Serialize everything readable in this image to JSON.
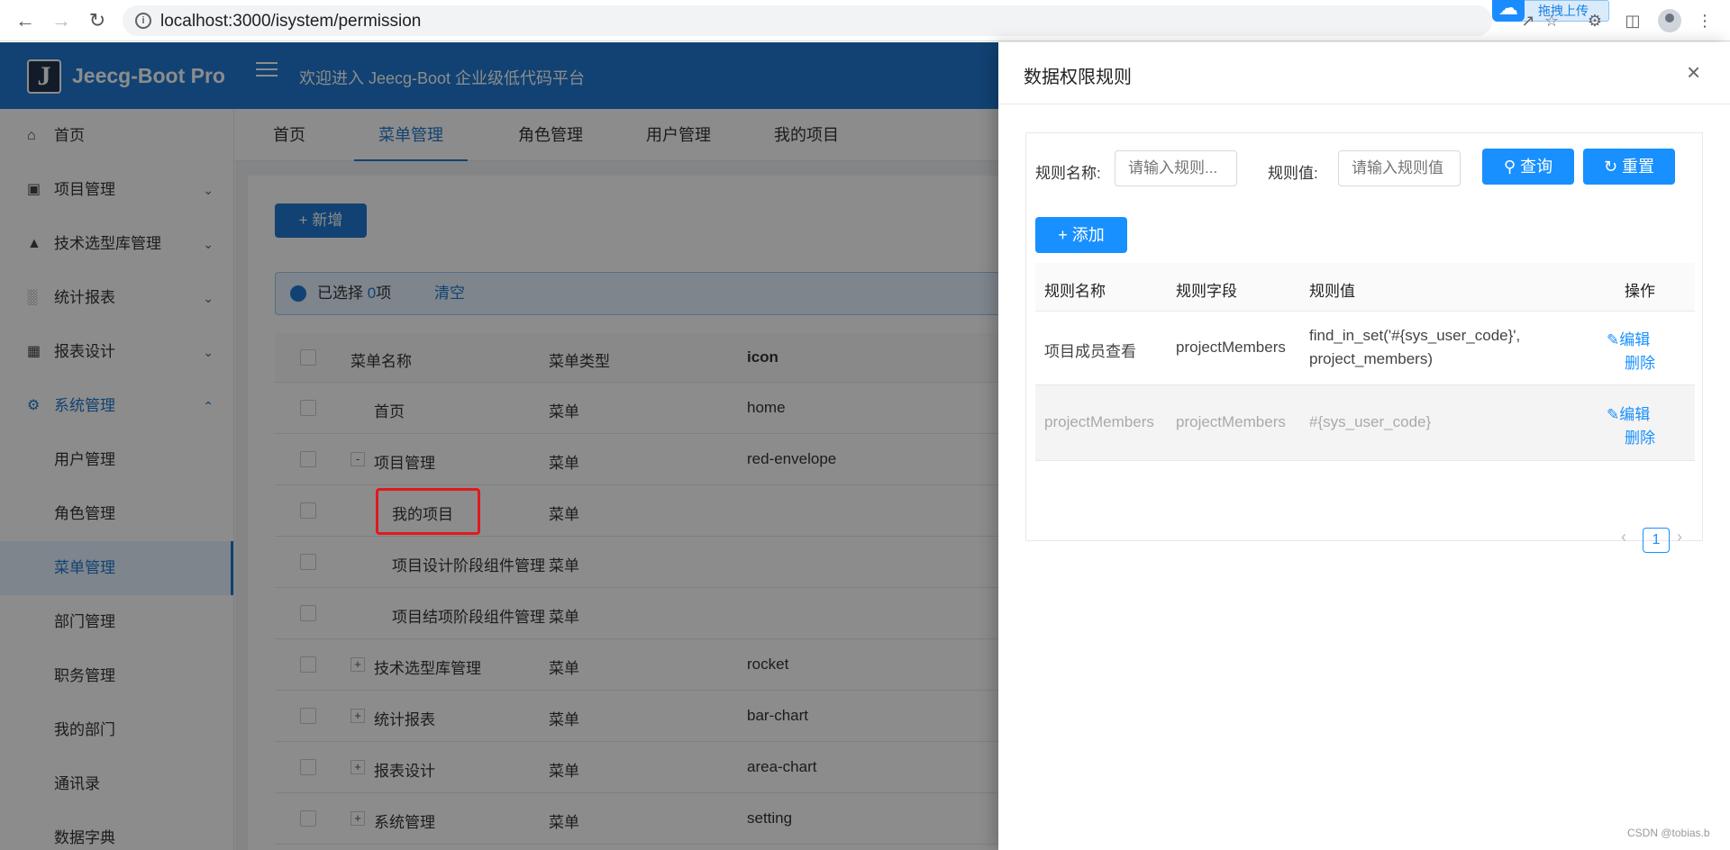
{
  "browser": {
    "url": "localhost:3000/isystem/permission",
    "upload_label": "拖拽上传"
  },
  "app": {
    "logo_letter": "J",
    "logo_text": "Jeecg-Boot Pro",
    "welcome": "欢迎进入 Jeecg-Boot 企业级低代码平台"
  },
  "sidebar": {
    "items": [
      {
        "label": "首页",
        "icon": "home-icon"
      },
      {
        "label": "项目管理",
        "icon": "project-icon"
      },
      {
        "label": "技术选型库管理",
        "icon": "rocket-icon"
      },
      {
        "label": "统计报表",
        "icon": "bar-chart-icon"
      },
      {
        "label": "报表设计",
        "icon": "area-chart-icon"
      },
      {
        "label": "系统管理",
        "icon": "setting-icon"
      }
    ],
    "sub_items": [
      "用户管理",
      "角色管理",
      "菜单管理",
      "部门管理",
      "职务管理",
      "我的部门",
      "通讯录",
      "数据字典"
    ]
  },
  "tabs": [
    "首页",
    "菜单管理",
    "角色管理",
    "用户管理",
    "我的项目"
  ],
  "toolbar": {
    "add_label": "新增"
  },
  "selection": {
    "prefix": "已选择 ",
    "count": "0",
    "suffix": "项",
    "clear": "清空"
  },
  "table": {
    "headers": [
      "菜单名称",
      "菜单类型",
      "icon"
    ],
    "rows": [
      {
        "name": "首页",
        "type": "菜单",
        "icon": "home"
      },
      {
        "name": "项目管理",
        "type": "菜单",
        "icon": "red-envelope",
        "expand": "-"
      },
      {
        "name": "我的项目",
        "type": "菜单",
        "icon": ""
      },
      {
        "name": "项目设计阶段组件管理",
        "type": "菜单",
        "icon": ""
      },
      {
        "name": "项目结项阶段组件管理",
        "type": "菜单",
        "icon": ""
      },
      {
        "name": "技术选型库管理",
        "type": "菜单",
        "icon": "rocket",
        "expand": "+"
      },
      {
        "name": "统计报表",
        "type": "菜单",
        "icon": "bar-chart",
        "expand": "+"
      },
      {
        "name": "报表设计",
        "type": "菜单",
        "icon": "area-chart",
        "expand": "+"
      },
      {
        "name": "系统管理",
        "type": "菜单",
        "icon": "setting",
        "expand": "+"
      }
    ]
  },
  "drawer": {
    "title": "数据权限规则",
    "rule_name_label": "规则名称:",
    "rule_name_placeholder": "请输入规则...",
    "rule_value_label": "规则值:",
    "rule_value_placeholder": "请输入规则值",
    "query_label": "查询",
    "reset_label": "重置",
    "add_label": "添加",
    "headers": [
      "规则名称",
      "规则字段",
      "规则值",
      "操作"
    ],
    "rows": [
      {
        "name": "项目成员查看",
        "field": "projectMembers",
        "value_line1": "find_in_set('#{sys_user_code}',",
        "value_line2": "project_members)",
        "edit": "编辑",
        "delete": "删除"
      },
      {
        "name": "projectMembers",
        "field": "projectMembers",
        "value_line1": "#{sys_user_code}",
        "value_line2": "",
        "edit": "编辑",
        "delete": "删除"
      }
    ],
    "page": "1"
  },
  "watermark": "CSDN @tobias.b"
}
